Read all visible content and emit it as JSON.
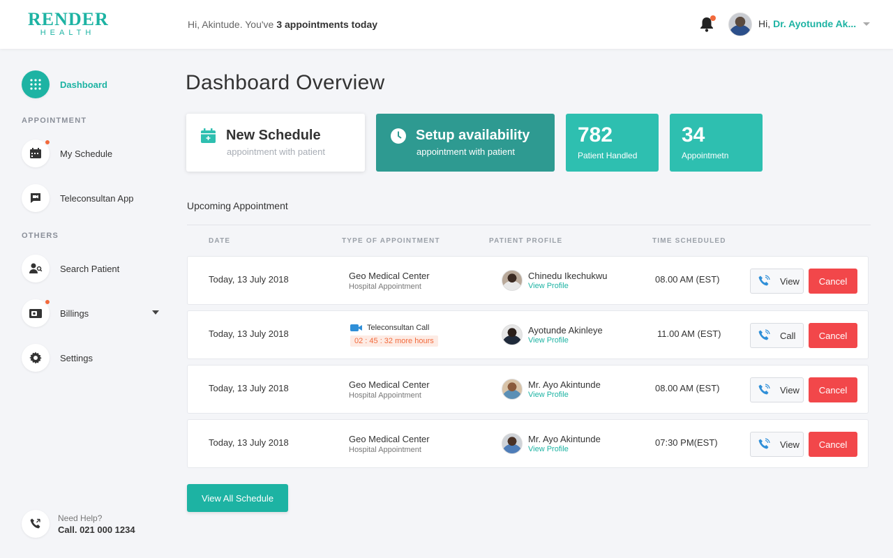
{
  "header": {
    "logo_main": "RENDER",
    "logo_sub": "HEALTH",
    "greeting_prefix": "Hi, Akintude. You've",
    "greeting_strong": "3 appointments today",
    "user_hi": "Hi,",
    "user_name": "Dr. Ayotunde Ak...",
    "icons": {
      "bell": "bell-icon",
      "caret": "caret-down-icon"
    }
  },
  "sidebar": {
    "dashboard": "Dashboard",
    "section_appointment": "APPOINTMENT",
    "my_schedule": "My Schedule",
    "teleconsultan_app": "Teleconsultan App",
    "section_others": "OTHERS",
    "search_patient": "Search Patient",
    "billings": "Billings",
    "settings": "Settings",
    "help_small": "Need Help?",
    "help_big": "Call. 021 000 1234"
  },
  "main": {
    "title": "Dashboard Overview",
    "cards": {
      "new_schedule_title": "New Schedule",
      "new_schedule_sub": "appointment with patient",
      "setup_title": "Setup availability",
      "setup_sub": "appointment with patient",
      "stat1_value": "782",
      "stat1_label": "Patient Handled",
      "stat2_value": "34",
      "stat2_label": "Appointmetn"
    },
    "section_title": "Upcoming Appointment",
    "columns": [
      "DATE",
      "TYPE OF APPOINTMENT",
      "PATIENT PROFILE",
      "TIME SCHEDULED"
    ],
    "rows": [
      {
        "date": "Today, 13 July 2018",
        "type_main": "Geo Medical Center",
        "type_sub": "Hospital Appointment",
        "patient": "Chinedu Ikechukwu",
        "link": "View Profile",
        "time": "08.00 AM (EST)",
        "action": "View",
        "cancel": "Cancel"
      },
      {
        "date": "Today, 13 July 2018",
        "type_main": "Teleconsultan Call",
        "type_sub": "02 : 45 : 32 more hours",
        "patient": "Ayotunde Akinleye",
        "link": "View Profile",
        "time": "11.00 AM (EST)",
        "action": "Call",
        "cancel": "Cancel"
      },
      {
        "date": "Today, 13 July 2018",
        "type_main": "Geo Medical Center",
        "type_sub": "Hospital Appointment",
        "patient": "Mr. Ayo Akintunde",
        "link": "View Profile",
        "time": "08.00 AM (EST)",
        "action": "View",
        "cancel": "Cancel"
      },
      {
        "date": "Today, 13 July 2018",
        "type_main": "Geo Medical Center",
        "type_sub": "Hospital Appointment",
        "patient": "Mr. Ayo Akintunde",
        "link": "View Profile",
        "time": "07:30 PM(EST)",
        "action": "View",
        "cancel": "Cancel"
      }
    ],
    "view_all": "View All Schedule"
  },
  "colors": {
    "accent": "#1db3a3",
    "accent_dark": "#2e9a91",
    "stat": "#2ebfb0",
    "danger": "#f2474a",
    "notify": "#f26a3c"
  }
}
